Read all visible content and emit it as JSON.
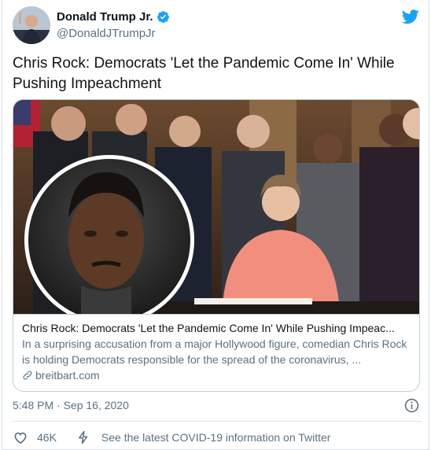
{
  "user": {
    "name": "Donald Trump Jr.",
    "handle": "@DonaldJTrumpJr",
    "avatar_icon": "profile-photo",
    "verified_icon": "verified-badge-icon"
  },
  "brand": {
    "icon": "twitter-bird-icon",
    "color": "#1da1f2"
  },
  "tweet": {
    "text_line1": "Chris Rock: Democrats 'Let the Pandemic Come In' While",
    "text_line2": "Pushing Impeachment"
  },
  "card": {
    "title": "Chris Rock: Democrats 'Let the Pandemic Come In' While Pushing Impeac...",
    "description": "In a surprising accusation from a major Hollywood figure, comedian Chris Rock is holding Democrats responsible for the spread of the coronavirus, ...",
    "domain": "breitbart.com",
    "image_icon": "news-photo"
  },
  "meta": {
    "timestamp": "5:48 PM · Sep 16, 2020"
  },
  "actions": {
    "like_count": "46K",
    "covid_info": "See the latest COVID-19 information on Twitter"
  },
  "colors": {
    "text": "#0f1419",
    "secondary": "#5b7083",
    "border": "#c4cfd6",
    "blue": "#1da1f2"
  }
}
